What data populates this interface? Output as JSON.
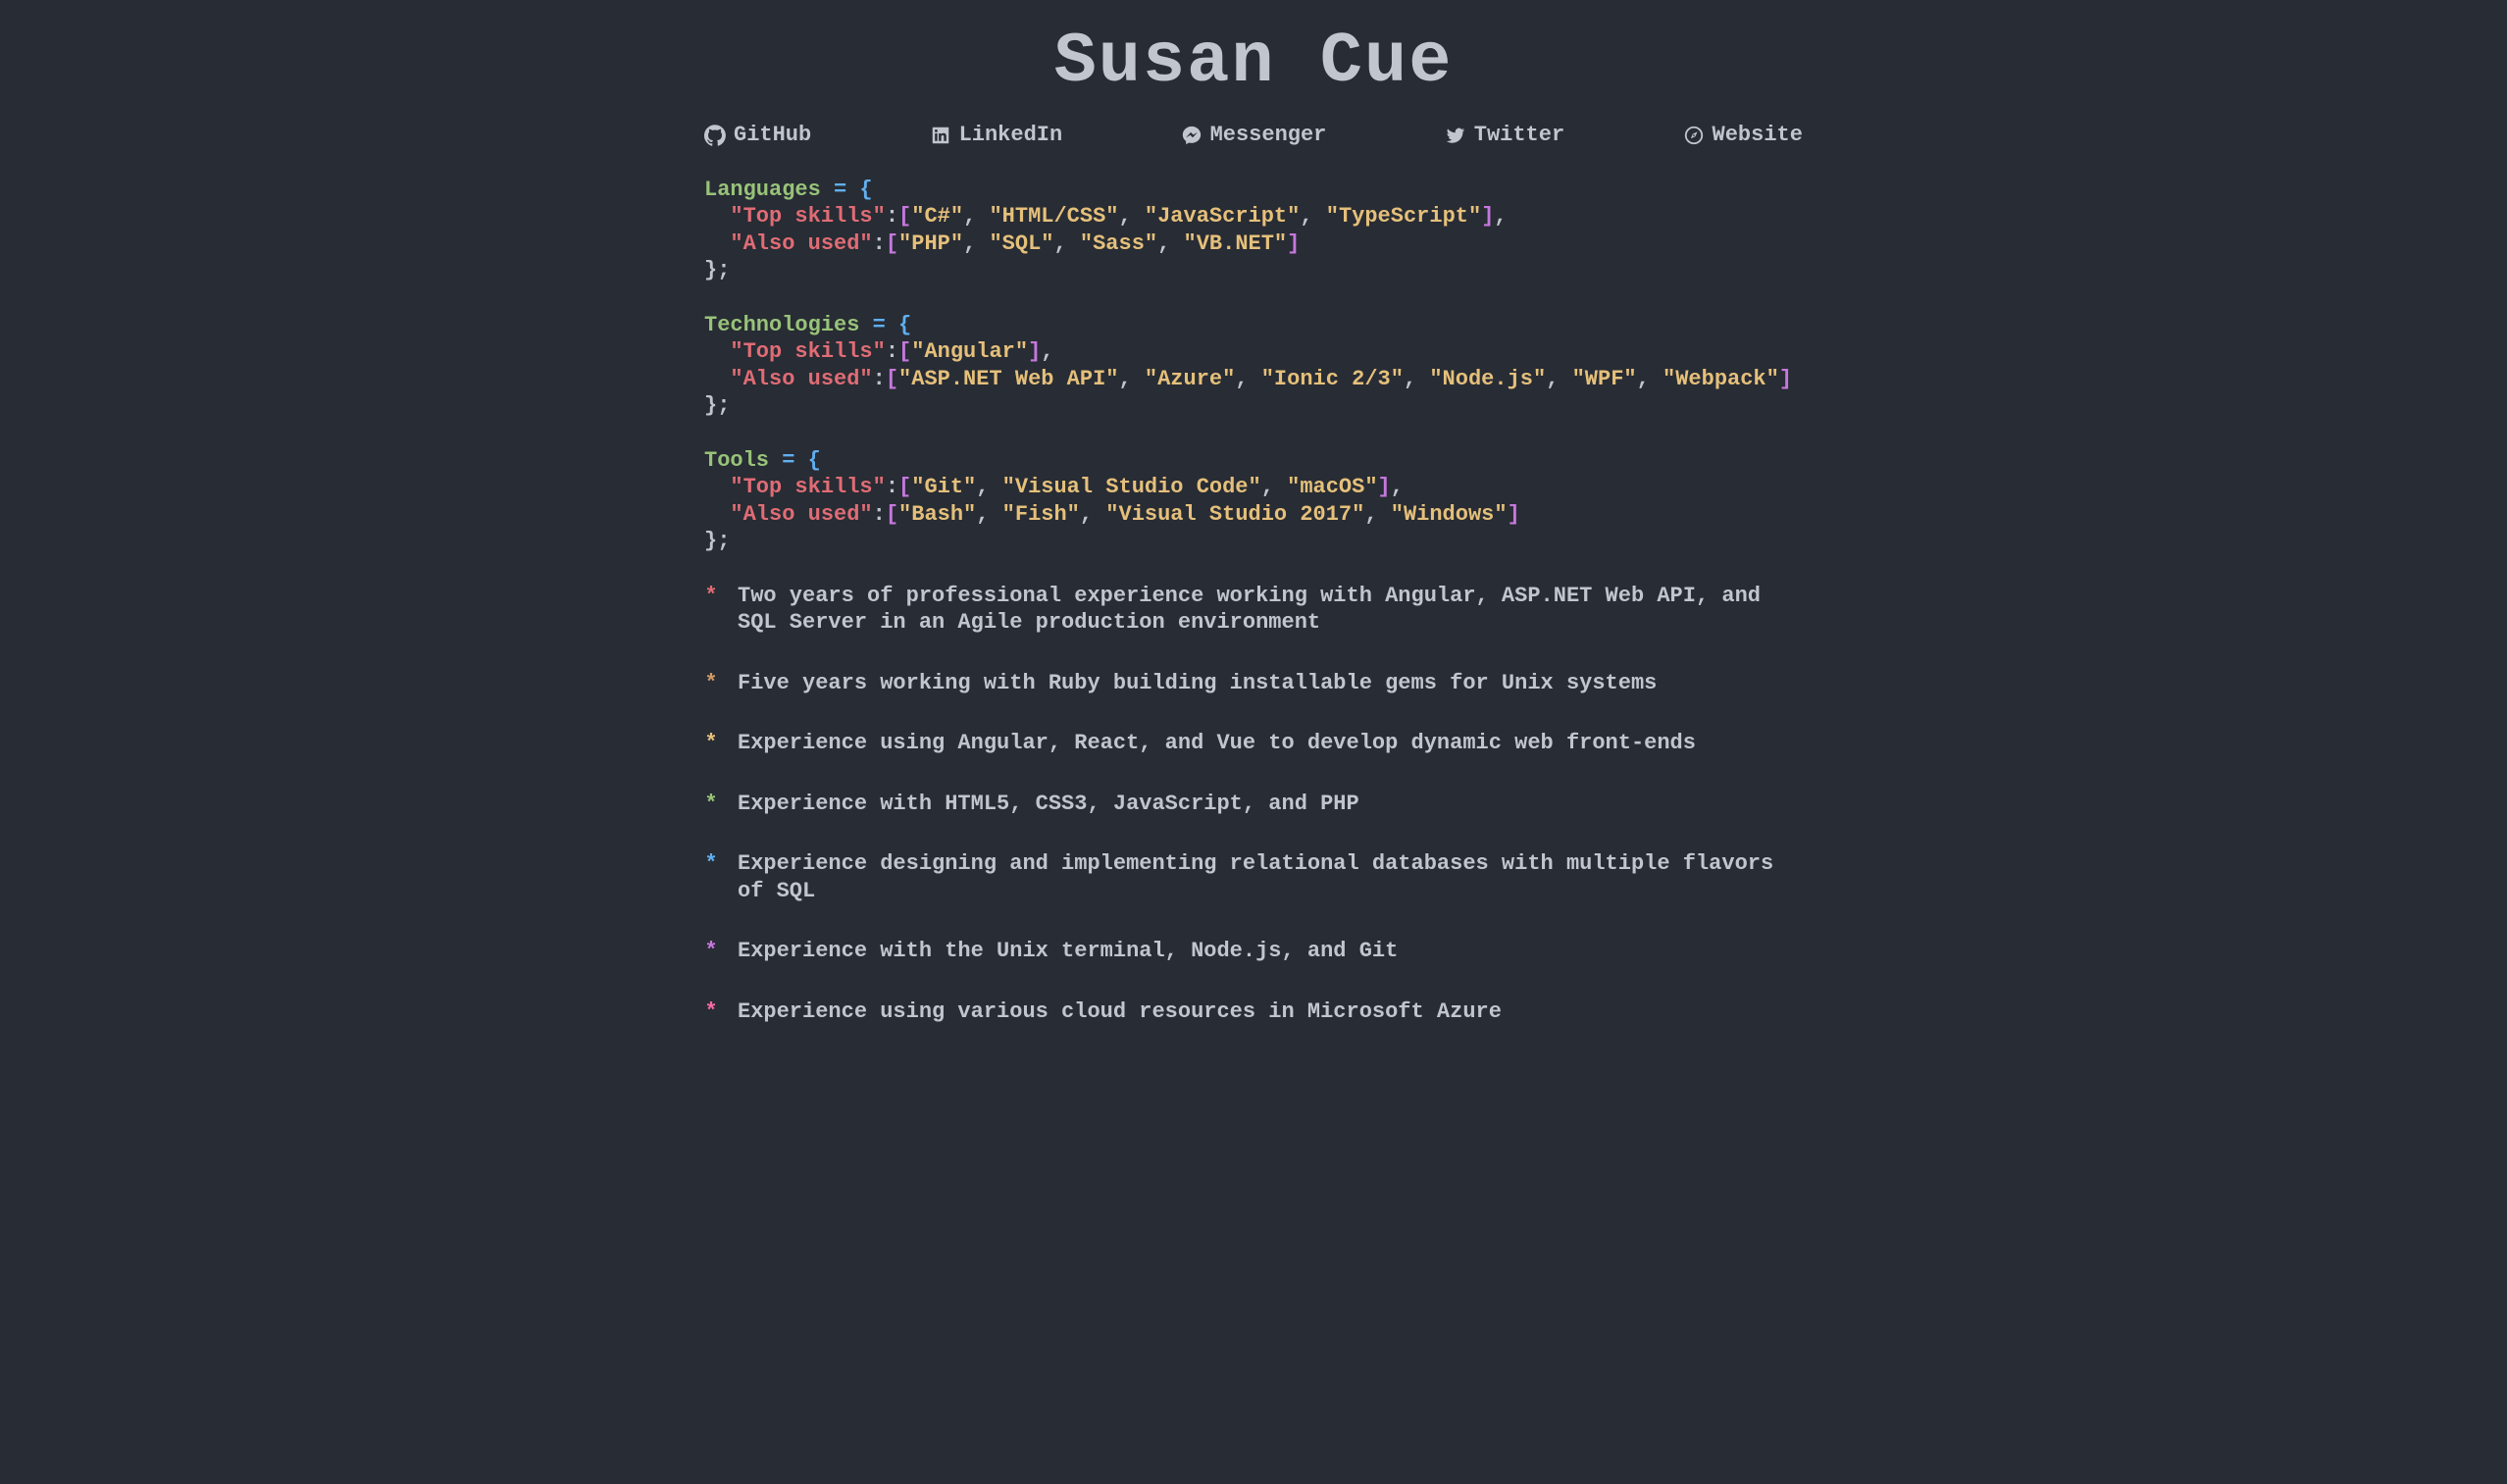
{
  "name": "Susan Cue",
  "links": [
    {
      "icon": "github",
      "label": "GitHub"
    },
    {
      "icon": "linkedin",
      "label": "LinkedIn"
    },
    {
      "icon": "messenger",
      "label": "Messenger"
    },
    {
      "icon": "twitter",
      "label": "Twitter"
    },
    {
      "icon": "website",
      "label": "Website"
    }
  ],
  "punct": {
    "eq_open": " = {",
    "colon": ":",
    "open_br": "[",
    "close_br": "]",
    "comma": ",",
    "close_obj": "};"
  },
  "sections": [
    {
      "var": "Languages",
      "rows": [
        {
          "key": "\"Top skills\"",
          "values": [
            "\"C#\"",
            "\"HTML/CSS\"",
            "\"JavaScript\"",
            "\"TypeScript\""
          ]
        },
        {
          "key": "\"Also used\"",
          "values": [
            "\"PHP\"",
            "\"SQL\"",
            "\"Sass\"",
            "\"VB.NET\""
          ]
        }
      ]
    },
    {
      "var": "Technologies",
      "rows": [
        {
          "key": "\"Top skills\"",
          "values": [
            "\"Angular\""
          ]
        },
        {
          "key": "\"Also used\"",
          "values": [
            "\"ASP.NET Web API\"",
            "\"Azure\"",
            "\"Ionic 2/3\"",
            "\"Node.js\"",
            "\"WPF\"",
            "\"Webpack\""
          ]
        }
      ]
    },
    {
      "var": "Tools",
      "rows": [
        {
          "key": "\"Top skills\"",
          "values": [
            "\"Git\"",
            "\"Visual Studio Code\"",
            "\"macOS\""
          ]
        },
        {
          "key": "\"Also used\"",
          "values": [
            "\"Bash\"",
            "\"Fish\"",
            "\"Visual Studio 2017\"",
            "\"Windows\""
          ]
        }
      ]
    }
  ],
  "bullets": [
    {
      "color": "c-red",
      "text": "Two years of professional experience working with Angular, ASP.NET Web API, and SQL Server in an Agile production environment"
    },
    {
      "color": "c-orange",
      "text": "Five years working with Ruby building installable gems for Unix systems"
    },
    {
      "color": "c-yellow",
      "text": "Experience using Angular, React, and Vue to develop dynamic web front-ends"
    },
    {
      "color": "c-green",
      "text": "Experience with HTML5, CSS3, JavaScript, and PHP"
    },
    {
      "color": "c-blue",
      "text": "Experience designing and implementing relational databases with multiple flavors of SQL"
    },
    {
      "color": "c-purple",
      "text": "Experience with the Unix terminal, Node.js, and Git"
    },
    {
      "color": "c-pink",
      "text": "Experience using various cloud resources in Microsoft Azure"
    }
  ]
}
